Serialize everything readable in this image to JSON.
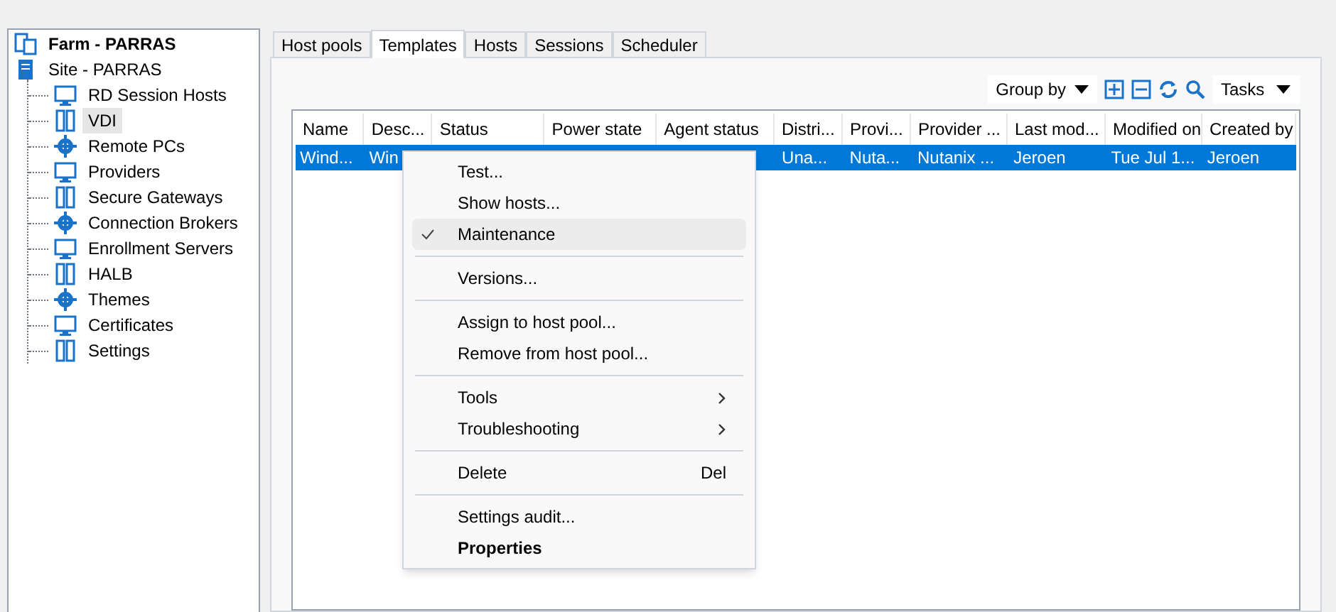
{
  "tree": [
    {
      "label": "Farm - PARRAS",
      "selected": false,
      "children": [
        {
          "label": "Site - PARRAS",
          "selected": false,
          "children": [
            {
              "label": "RD Session Hosts",
              "selected": false
            },
            {
              "label": "VDI",
              "selected": true
            },
            {
              "label": "Remote PCs",
              "selected": false
            },
            {
              "label": "Providers",
              "selected": false
            },
            {
              "label": "Secure Gateways",
              "selected": false
            },
            {
              "label": "Connection Brokers",
              "selected": false
            },
            {
              "label": "Enrollment Servers",
              "selected": false
            },
            {
              "label": "HALB",
              "selected": false
            },
            {
              "label": "Themes",
              "selected": false
            },
            {
              "label": "Certificates",
              "selected": false
            },
            {
              "label": "Settings",
              "selected": false
            }
          ]
        }
      ]
    }
  ],
  "tabs": [
    {
      "label": "Host pools",
      "selected": false
    },
    {
      "label": "Templates",
      "selected": true
    },
    {
      "label": "Hosts",
      "selected": false
    },
    {
      "label": "Sessions",
      "selected": false
    },
    {
      "label": "Scheduler",
      "selected": false
    }
  ],
  "toolbar": {
    "group_by": "Group by",
    "tasks": "Tasks"
  },
  "table": {
    "columns": [
      "Name",
      "Desc...",
      "Status",
      "Power state",
      "Agent status",
      "Distri...",
      "Provi...",
      "Provider ...",
      "Last mod...",
      "Modified on",
      "Created by"
    ],
    "rows": [
      {
        "selected": true,
        "cells": [
          "Wind...",
          "Win",
          "",
          "",
          "",
          "Una...",
          "Nuta...",
          "Nutanix ...",
          "Jeroen",
          "Tue Jul 1...",
          "Jeroen"
        ]
      }
    ]
  },
  "context_menu": [
    {
      "kind": "item",
      "label": "Test...",
      "checked": false,
      "highlighted": false
    },
    {
      "kind": "item",
      "label": "Show hosts...",
      "checked": false,
      "highlighted": false
    },
    {
      "kind": "item",
      "label": "Maintenance",
      "checked": true,
      "highlighted": true
    },
    {
      "kind": "separator"
    },
    {
      "kind": "item",
      "label": "Versions...",
      "checked": false,
      "highlighted": false
    },
    {
      "kind": "separator"
    },
    {
      "kind": "item",
      "label": "Assign to host pool...",
      "checked": false,
      "highlighted": false
    },
    {
      "kind": "item",
      "label": "Remove from host pool...",
      "checked": false,
      "highlighted": false
    },
    {
      "kind": "separator"
    },
    {
      "kind": "submenu",
      "label": "Tools",
      "checked": false,
      "highlighted": false
    },
    {
      "kind": "submenu",
      "label": "Troubleshooting",
      "checked": false,
      "highlighted": false
    },
    {
      "kind": "separator"
    },
    {
      "kind": "item",
      "label": "Delete",
      "shortcut": "Del",
      "checked": false,
      "highlighted": false
    },
    {
      "kind": "separator"
    },
    {
      "kind": "item",
      "label": "Settings audit...",
      "checked": false,
      "highlighted": false
    },
    {
      "kind": "default",
      "label": "Properties",
      "checked": false,
      "highlighted": false
    }
  ]
}
